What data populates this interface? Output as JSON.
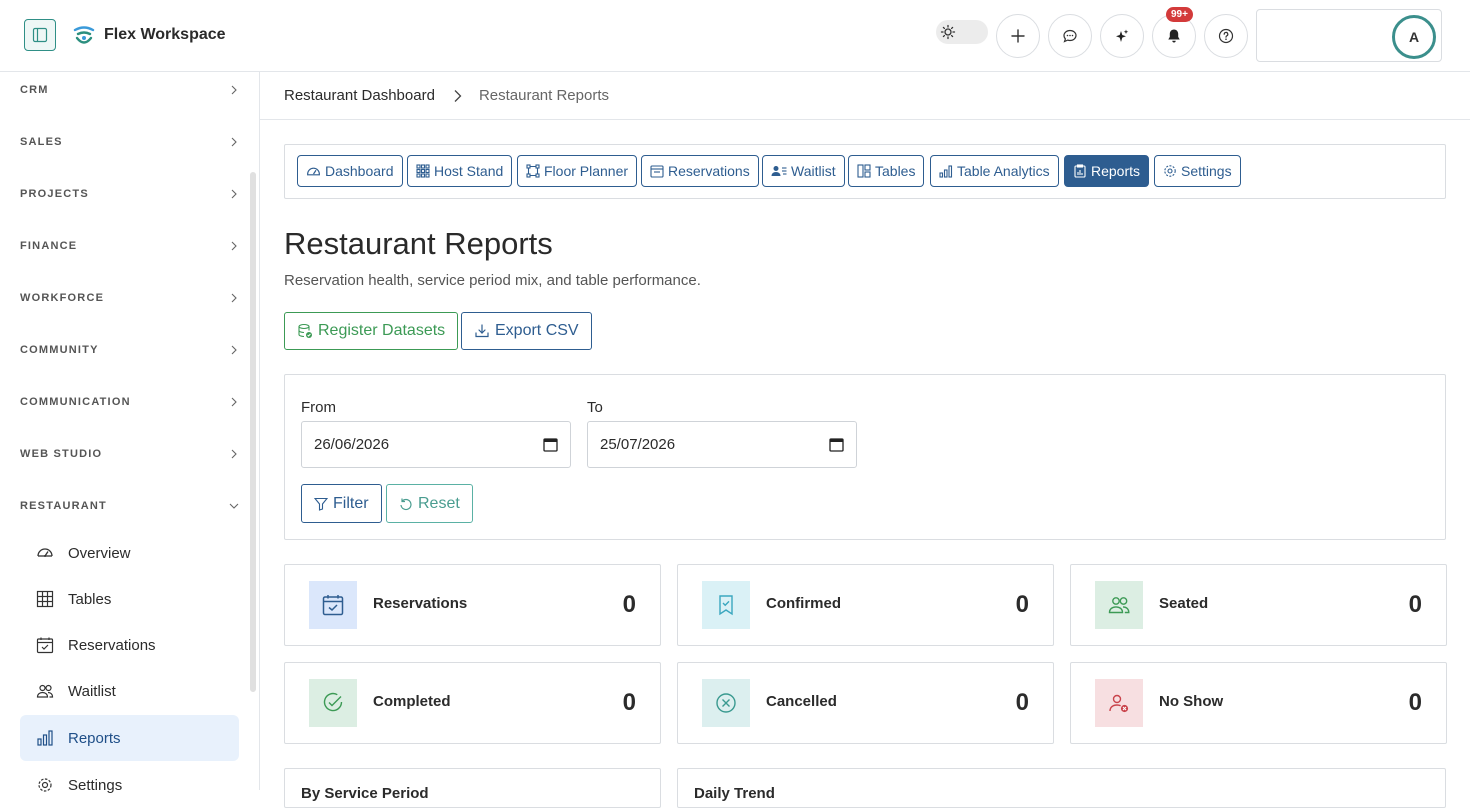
{
  "app": {
    "title": "Flex Workspace"
  },
  "header": {
    "notifications_badge": "99+",
    "avatar_initial": "A"
  },
  "sidebar": {
    "sections": [
      {
        "label": "CRM",
        "expanded": false
      },
      {
        "label": "SALES",
        "expanded": false
      },
      {
        "label": "PROJECTS",
        "expanded": false
      },
      {
        "label": "FINANCE",
        "expanded": false
      },
      {
        "label": "WORKFORCE",
        "expanded": false
      },
      {
        "label": "COMMUNITY",
        "expanded": false
      },
      {
        "label": "COMMUNICATION",
        "expanded": false
      },
      {
        "label": "WEB STUDIO",
        "expanded": false
      },
      {
        "label": "RESTAURANT",
        "expanded": true
      }
    ],
    "restaurant_items": [
      {
        "label": "Overview",
        "icon": "speedometer-icon"
      },
      {
        "label": "Tables",
        "icon": "grid-icon"
      },
      {
        "label": "Reservations",
        "icon": "calendar-check-icon"
      },
      {
        "label": "Waitlist",
        "icon": "people-icon"
      },
      {
        "label": "Reports",
        "icon": "bar-chart-icon",
        "active": true
      },
      {
        "label": "Settings",
        "icon": "gear-icon"
      }
    ]
  },
  "breadcrumb": {
    "parent": "Restaurant Dashboard",
    "current": "Restaurant Reports"
  },
  "tabs": [
    {
      "label": "Dashboard",
      "icon": "speedometer-icon"
    },
    {
      "label": "Host Stand",
      "icon": "grid-dots-icon"
    },
    {
      "label": "Floor Planner",
      "icon": "bounding-box-icon"
    },
    {
      "label": "Reservations",
      "icon": "calendar-icon"
    },
    {
      "label": "Waitlist",
      "icon": "person-lines-icon"
    },
    {
      "label": "Tables",
      "icon": "layout-icon"
    },
    {
      "label": "Table Analytics",
      "icon": "bar-chart-icon"
    },
    {
      "label": "Reports",
      "icon": "clipboard-data-icon",
      "active": true
    },
    {
      "label": "Settings",
      "icon": "gear-icon"
    }
  ],
  "page": {
    "title": "Restaurant Reports",
    "subtitle": "Reservation health, service period mix, and table performance."
  },
  "actions": {
    "register": "Register Datasets",
    "export": "Export CSV"
  },
  "filters": {
    "from_label": "From",
    "from_value": "26/06/2026",
    "to_label": "To",
    "to_value": "25/07/2026",
    "filter_label": "Filter",
    "reset_label": "Reset"
  },
  "stats": [
    {
      "label": "Reservations",
      "value": "0",
      "icon": "calendar-check-icon",
      "color": "#dbe7fb"
    },
    {
      "label": "Confirmed",
      "value": "0",
      "icon": "bookmark-check-icon",
      "color": "#daf1f6"
    },
    {
      "label": "Seated",
      "value": "0",
      "icon": "people-icon",
      "color": "#dceee3"
    },
    {
      "label": "Completed",
      "value": "0",
      "icon": "check-circle-icon",
      "color": "#dceee3"
    },
    {
      "label": "Cancelled",
      "value": "0",
      "icon": "x-circle-icon",
      "color": "#dcefef"
    },
    {
      "label": "No Show",
      "value": "0",
      "icon": "person-x-icon",
      "color": "#f7dfe1"
    }
  ],
  "panels": {
    "by_service_period": "By Service Period",
    "daily_trend": "Daily Trend"
  }
}
